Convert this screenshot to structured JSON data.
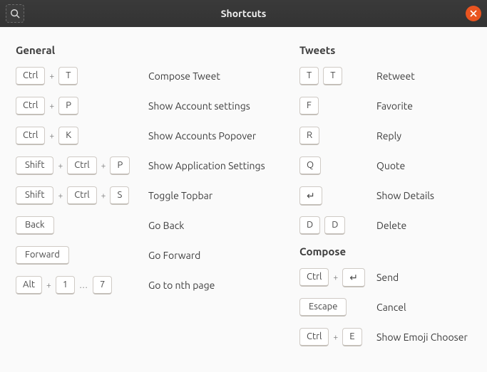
{
  "window": {
    "title": "Shortcuts"
  },
  "symbols": {
    "plus": "+",
    "dots": "…"
  },
  "sections": {
    "general": {
      "title": "General",
      "items": [
        {
          "keys": [
            "Ctrl",
            "T"
          ],
          "desc": "Compose Tweet"
        },
        {
          "keys": [
            "Ctrl",
            "P"
          ],
          "desc": "Show Account settings"
        },
        {
          "keys": [
            "Ctrl",
            "K"
          ],
          "desc": "Show Accounts Popover"
        },
        {
          "keys": [
            "Shift",
            "Ctrl",
            "P"
          ],
          "desc": "Show Application Settings"
        },
        {
          "keys": [
            "Shift",
            "Ctrl",
            "S"
          ],
          "desc": "Toggle Topbar"
        },
        {
          "keys": [
            "Back"
          ],
          "desc": "Go Back"
        },
        {
          "keys": [
            "Forward"
          ],
          "desc": "Go Forward"
        },
        {
          "keys": [
            "Alt",
            "1",
            "7"
          ],
          "range": true,
          "desc": "Go to nth page"
        }
      ]
    },
    "tweets": {
      "title": "Tweets",
      "items": [
        {
          "keys": [
            "T",
            "T"
          ],
          "seq": true,
          "desc": "Retweet"
        },
        {
          "keys": [
            "F"
          ],
          "desc": "Favorite"
        },
        {
          "keys": [
            "R"
          ],
          "desc": "Reply"
        },
        {
          "keys": [
            "Q"
          ],
          "desc": "Quote"
        },
        {
          "keys": [
            "↵"
          ],
          "desc": "Show Details"
        },
        {
          "keys": [
            "D",
            "D"
          ],
          "seq": true,
          "desc": "Delete"
        }
      ]
    },
    "compose": {
      "title": "Compose",
      "items": [
        {
          "keys": [
            "Ctrl",
            "↵"
          ],
          "desc": "Send"
        },
        {
          "keys": [
            "Escape"
          ],
          "desc": "Cancel"
        },
        {
          "keys": [
            "Ctrl",
            "E"
          ],
          "desc": "Show Emoji Chooser"
        }
      ]
    }
  }
}
